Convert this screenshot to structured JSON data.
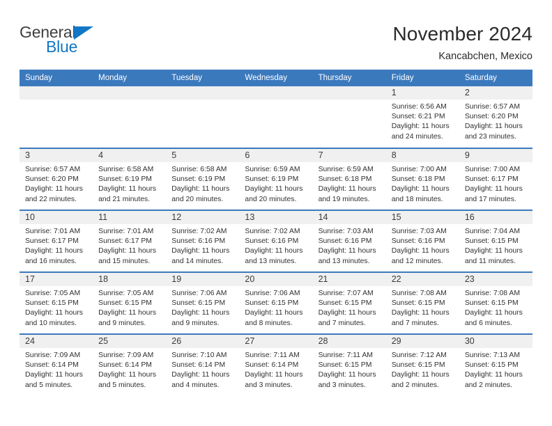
{
  "brand": {
    "name_primary": "General",
    "name_secondary": "Blue",
    "triangle_color": "#1277c4"
  },
  "header": {
    "title": "November 2024",
    "subtitle": "Kancabchen, Mexico"
  },
  "theme": {
    "header_blue": "#3b79bd",
    "daynum_band": "#f0f0f0",
    "text": "#2b2b2b"
  },
  "weekday_headers": [
    "Sunday",
    "Monday",
    "Tuesday",
    "Wednesday",
    "Thursday",
    "Friday",
    "Saturday"
  ],
  "labels": {
    "sunrise_prefix": "Sunrise: ",
    "sunset_prefix": "Sunset: ",
    "daylight_prefix": "Daylight: "
  },
  "weeks": [
    [
      {
        "day": "",
        "blank": true
      },
      {
        "day": "",
        "blank": true
      },
      {
        "day": "",
        "blank": true
      },
      {
        "day": "",
        "blank": true
      },
      {
        "day": "",
        "blank": true
      },
      {
        "day": "1",
        "sunrise": "Sunrise: 6:56 AM",
        "sunset": "Sunset: 6:21 PM",
        "daylight": "Daylight: 11 hours and 24 minutes."
      },
      {
        "day": "2",
        "sunrise": "Sunrise: 6:57 AM",
        "sunset": "Sunset: 6:20 PM",
        "daylight": "Daylight: 11 hours and 23 minutes."
      }
    ],
    [
      {
        "day": "3",
        "sunrise": "Sunrise: 6:57 AM",
        "sunset": "Sunset: 6:20 PM",
        "daylight": "Daylight: 11 hours and 22 minutes."
      },
      {
        "day": "4",
        "sunrise": "Sunrise: 6:58 AM",
        "sunset": "Sunset: 6:19 PM",
        "daylight": "Daylight: 11 hours and 21 minutes."
      },
      {
        "day": "5",
        "sunrise": "Sunrise: 6:58 AM",
        "sunset": "Sunset: 6:19 PM",
        "daylight": "Daylight: 11 hours and 20 minutes."
      },
      {
        "day": "6",
        "sunrise": "Sunrise: 6:59 AM",
        "sunset": "Sunset: 6:19 PM",
        "daylight": "Daylight: 11 hours and 20 minutes."
      },
      {
        "day": "7",
        "sunrise": "Sunrise: 6:59 AM",
        "sunset": "Sunset: 6:18 PM",
        "daylight": "Daylight: 11 hours and 19 minutes."
      },
      {
        "day": "8",
        "sunrise": "Sunrise: 7:00 AM",
        "sunset": "Sunset: 6:18 PM",
        "daylight": "Daylight: 11 hours and 18 minutes."
      },
      {
        "day": "9",
        "sunrise": "Sunrise: 7:00 AM",
        "sunset": "Sunset: 6:17 PM",
        "daylight": "Daylight: 11 hours and 17 minutes."
      }
    ],
    [
      {
        "day": "10",
        "sunrise": "Sunrise: 7:01 AM",
        "sunset": "Sunset: 6:17 PM",
        "daylight": "Daylight: 11 hours and 16 minutes."
      },
      {
        "day": "11",
        "sunrise": "Sunrise: 7:01 AM",
        "sunset": "Sunset: 6:17 PM",
        "daylight": "Daylight: 11 hours and 15 minutes."
      },
      {
        "day": "12",
        "sunrise": "Sunrise: 7:02 AM",
        "sunset": "Sunset: 6:16 PM",
        "daylight": "Daylight: 11 hours and 14 minutes."
      },
      {
        "day": "13",
        "sunrise": "Sunrise: 7:02 AM",
        "sunset": "Sunset: 6:16 PM",
        "daylight": "Daylight: 11 hours and 13 minutes."
      },
      {
        "day": "14",
        "sunrise": "Sunrise: 7:03 AM",
        "sunset": "Sunset: 6:16 PM",
        "daylight": "Daylight: 11 hours and 13 minutes."
      },
      {
        "day": "15",
        "sunrise": "Sunrise: 7:03 AM",
        "sunset": "Sunset: 6:16 PM",
        "daylight": "Daylight: 11 hours and 12 minutes."
      },
      {
        "day": "16",
        "sunrise": "Sunrise: 7:04 AM",
        "sunset": "Sunset: 6:15 PM",
        "daylight": "Daylight: 11 hours and 11 minutes."
      }
    ],
    [
      {
        "day": "17",
        "sunrise": "Sunrise: 7:05 AM",
        "sunset": "Sunset: 6:15 PM",
        "daylight": "Daylight: 11 hours and 10 minutes."
      },
      {
        "day": "18",
        "sunrise": "Sunrise: 7:05 AM",
        "sunset": "Sunset: 6:15 PM",
        "daylight": "Daylight: 11 hours and 9 minutes."
      },
      {
        "day": "19",
        "sunrise": "Sunrise: 7:06 AM",
        "sunset": "Sunset: 6:15 PM",
        "daylight": "Daylight: 11 hours and 9 minutes."
      },
      {
        "day": "20",
        "sunrise": "Sunrise: 7:06 AM",
        "sunset": "Sunset: 6:15 PM",
        "daylight": "Daylight: 11 hours and 8 minutes."
      },
      {
        "day": "21",
        "sunrise": "Sunrise: 7:07 AM",
        "sunset": "Sunset: 6:15 PM",
        "daylight": "Daylight: 11 hours and 7 minutes."
      },
      {
        "day": "22",
        "sunrise": "Sunrise: 7:08 AM",
        "sunset": "Sunset: 6:15 PM",
        "daylight": "Daylight: 11 hours and 7 minutes."
      },
      {
        "day": "23",
        "sunrise": "Sunrise: 7:08 AM",
        "sunset": "Sunset: 6:15 PM",
        "daylight": "Daylight: 11 hours and 6 minutes."
      }
    ],
    [
      {
        "day": "24",
        "sunrise": "Sunrise: 7:09 AM",
        "sunset": "Sunset: 6:14 PM",
        "daylight": "Daylight: 11 hours and 5 minutes."
      },
      {
        "day": "25",
        "sunrise": "Sunrise: 7:09 AM",
        "sunset": "Sunset: 6:14 PM",
        "daylight": "Daylight: 11 hours and 5 minutes."
      },
      {
        "day": "26",
        "sunrise": "Sunrise: 7:10 AM",
        "sunset": "Sunset: 6:14 PM",
        "daylight": "Daylight: 11 hours and 4 minutes."
      },
      {
        "day": "27",
        "sunrise": "Sunrise: 7:11 AM",
        "sunset": "Sunset: 6:14 PM",
        "daylight": "Daylight: 11 hours and 3 minutes."
      },
      {
        "day": "28",
        "sunrise": "Sunrise: 7:11 AM",
        "sunset": "Sunset: 6:15 PM",
        "daylight": "Daylight: 11 hours and 3 minutes."
      },
      {
        "day": "29",
        "sunrise": "Sunrise: 7:12 AM",
        "sunset": "Sunset: 6:15 PM",
        "daylight": "Daylight: 11 hours and 2 minutes."
      },
      {
        "day": "30",
        "sunrise": "Sunrise: 7:13 AM",
        "sunset": "Sunset: 6:15 PM",
        "daylight": "Daylight: 11 hours and 2 minutes."
      }
    ]
  ]
}
